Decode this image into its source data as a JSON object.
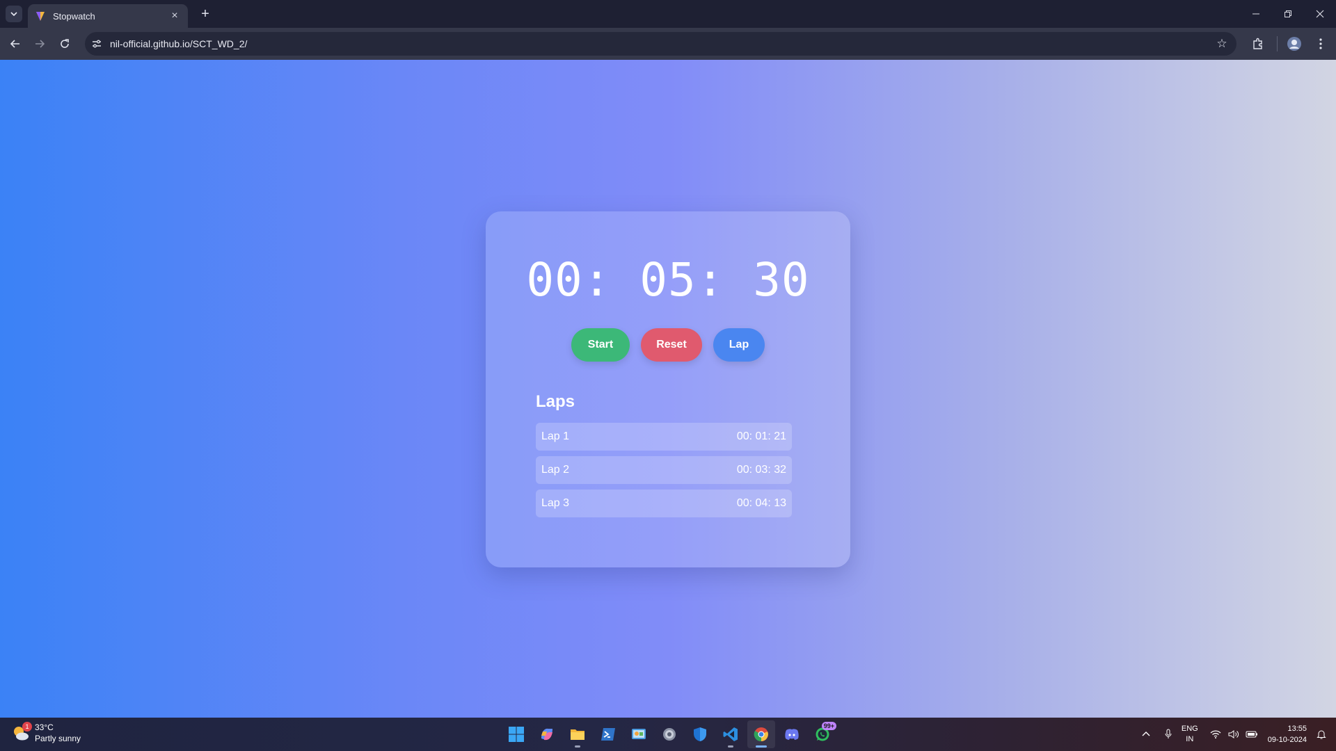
{
  "browser": {
    "tab_title": "Stopwatch",
    "url": "nil-official.github.io/SCT_WD_2/"
  },
  "stopwatch": {
    "time": "00: 05: 30",
    "buttons": {
      "start": "Start",
      "reset": "Reset",
      "lap": "Lap"
    },
    "laps_title": "Laps",
    "laps": [
      {
        "label": "Lap 1",
        "time": "00: 01: 21"
      },
      {
        "label": "Lap 2",
        "time": "00: 03: 32"
      },
      {
        "label": "Lap 3",
        "time": "00: 04: 13"
      }
    ]
  },
  "taskbar": {
    "weather_temp": "33°C",
    "weather_desc": "Partly sunny",
    "weather_badge": "1",
    "whatsapp_badge": "99+",
    "lang_line1": "ENG",
    "lang_line2": "IN",
    "time": "13:55",
    "date": "09-10-2024"
  },
  "colors": {
    "start": "#3cb878",
    "reset": "#e05a6e",
    "lap": "#4a86f0"
  }
}
